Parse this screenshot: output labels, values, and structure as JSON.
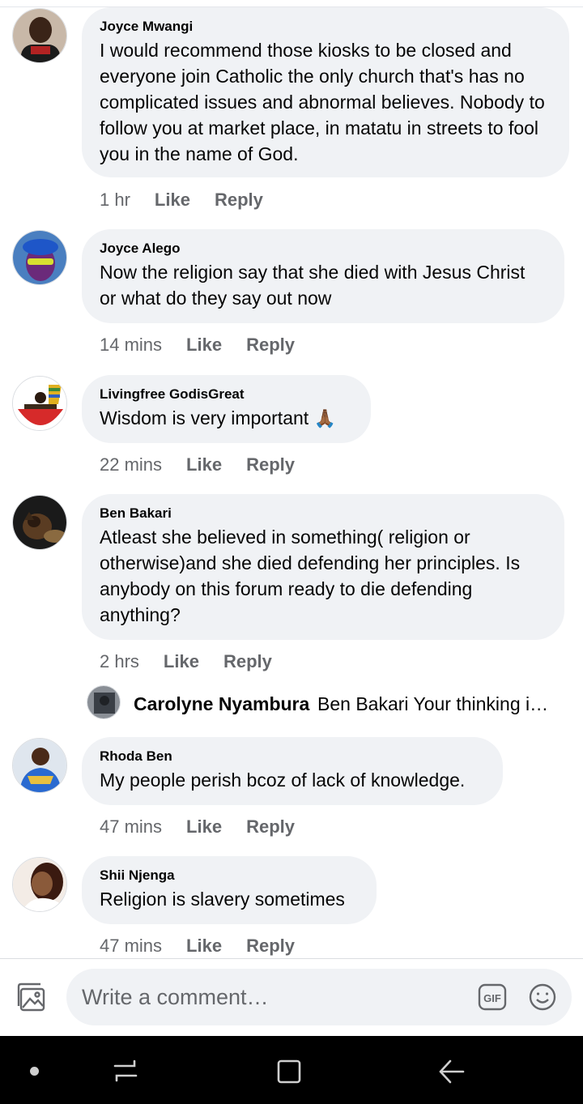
{
  "comments": [
    {
      "author": "Joyce Mwangi",
      "text": "I would recommend those kiosks to be closed and everyone join Catholic the only church that's has no complicated issues and abnormal believes. Nobody to follow you at market place, in matatu in streets to fool you in the name of God.",
      "time": "1 hr",
      "like_label": "Like",
      "reply_label": "Reply"
    },
    {
      "author": "Joyce Alego",
      "text": "Now the religion say that she died with Jesus Christ or what do they say out now",
      "time": "14 mins",
      "like_label": "Like",
      "reply_label": "Reply"
    },
    {
      "author": "Livingfree GodisGreat",
      "text": "Wisdom is very important",
      "emoji": "🙏🏾",
      "time": "22 mins",
      "like_label": "Like",
      "reply_label": "Reply"
    },
    {
      "author": "Ben Bakari",
      "text": "Atleast she believed in something( religion or otherwise)and she died defending her principles.  Is anybody on this forum ready to die defending anything?",
      "time": "2 hrs",
      "like_label": "Like",
      "reply_label": "Reply",
      "reply_preview": {
        "author": "Carolyne Nyambura",
        "text": "Ben Bakari Your thinking is hanging"
      }
    },
    {
      "author": "Rhoda Ben",
      "text": "My people perish bcoz of lack of knowledge.",
      "time": "47 mins",
      "like_label": "Like",
      "reply_label": "Reply"
    },
    {
      "author": "Shii Njenga",
      "text": "Religion is slavery sometimes",
      "time": "47 mins",
      "like_label": "Like",
      "reply_label": "Reply"
    }
  ],
  "composer": {
    "placeholder": "Write a comment…",
    "gif_label": "GIF",
    "photo_icon": "photo-icon",
    "emoji_icon": "emoji-icon"
  },
  "navbar": {
    "icons": [
      "dot-icon",
      "recent-apps-icon",
      "home-icon",
      "back-icon"
    ]
  },
  "colors": {
    "bubble": "#f0f2f5",
    "meta_text": "#65676b",
    "navbar": "#000000"
  }
}
